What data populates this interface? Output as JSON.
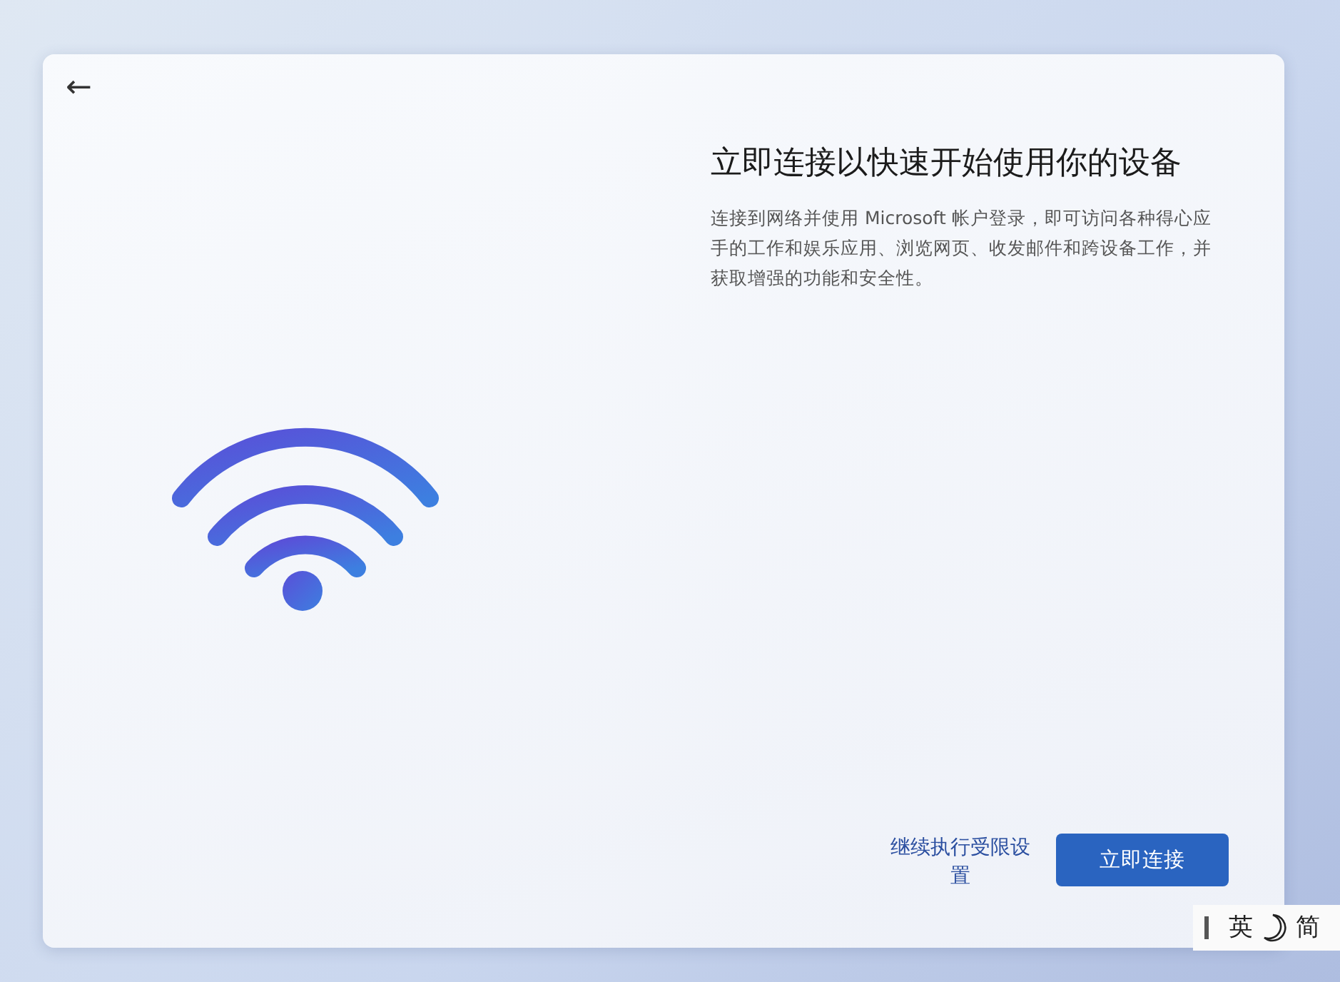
{
  "dialog": {
    "back": "←",
    "title": "立即连接以快速开始使用你的设备",
    "description": "连接到网络并使用 Microsoft 帐户登录，即可访问各种得心应手的工作和娱乐应用、浏览网页、收发邮件和跨设备工作，并获取增强的功能和安全性。",
    "buttons": [
      {
        "kind": "link",
        "label": "继续执行受限设置"
      },
      {
        "kind": "primary",
        "label": "立即连接"
      }
    ]
  },
  "ime_bar": {
    "items": [
      "英",
      "简"
    ]
  }
}
